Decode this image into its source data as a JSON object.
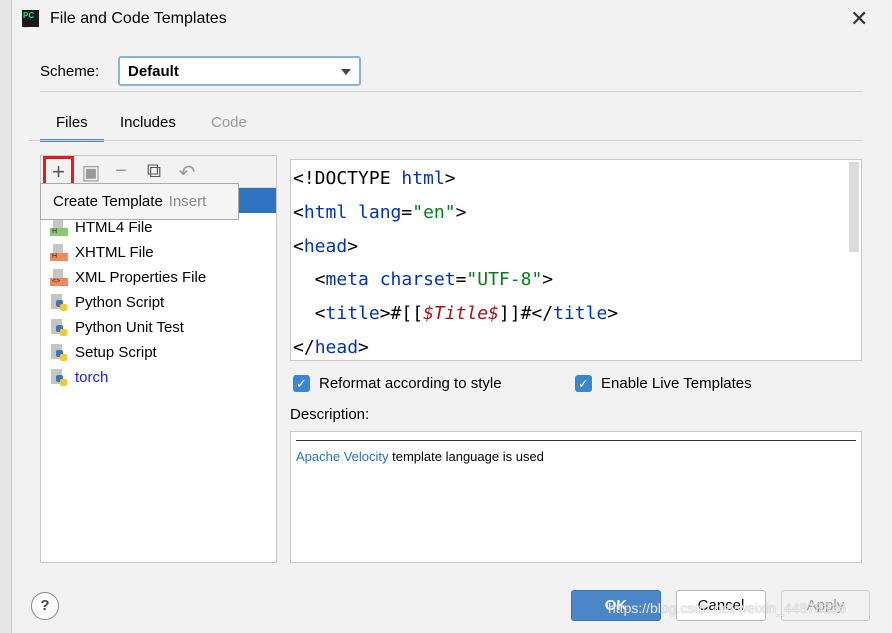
{
  "window": {
    "title": "File and Code Templates",
    "logo_text": "PC"
  },
  "scheme": {
    "label": "Scheme:",
    "value": "Default"
  },
  "tabs": [
    {
      "label": "Files",
      "selected": true
    },
    {
      "label": "Includes"
    },
    {
      "label": "Code",
      "disabled": true
    }
  ],
  "toolbar": {
    "add": "+",
    "popup_label": "Create Template",
    "popup_shortcut": "Insert"
  },
  "templates": [
    {
      "label": "HTML4 File",
      "icon": "html-file-icon",
      "badge": "H",
      "color": "#8cc773"
    },
    {
      "label": "XHTML File",
      "icon": "xhtml-file-icon",
      "badge": "H",
      "color": "#f08a5d"
    },
    {
      "label": "XML Properties File",
      "icon": "xml-file-icon",
      "badge": "<>",
      "color": "#f08a5d"
    },
    {
      "label": "Python Script",
      "icon": "python-file-icon"
    },
    {
      "label": "Python Unit Test",
      "icon": "python-file-icon"
    },
    {
      "label": "Setup Script",
      "icon": "python-file-icon"
    },
    {
      "label": "torch",
      "icon": "python-file-icon",
      "color": "#2020e0"
    }
  ],
  "editor": {
    "lines": [
      "<!DOCTYPE html>",
      "<html lang=\"en\">",
      "<head>",
      "  <meta charset=\"UTF-8\">",
      "  <title>#[[$Title$]]#</title>",
      "</head>"
    ]
  },
  "options": {
    "reformat": "Reformat according to style",
    "live": "Enable Live Templates"
  },
  "description": {
    "label": "Description:",
    "link": "Apache Velocity",
    "text": " template language is used"
  },
  "buttons": {
    "help": "?",
    "ok": "OK",
    "cancel": "Cancel",
    "apply": "Apply"
  },
  "watermark": "https://blog.csdn.net/weixin_44878336"
}
